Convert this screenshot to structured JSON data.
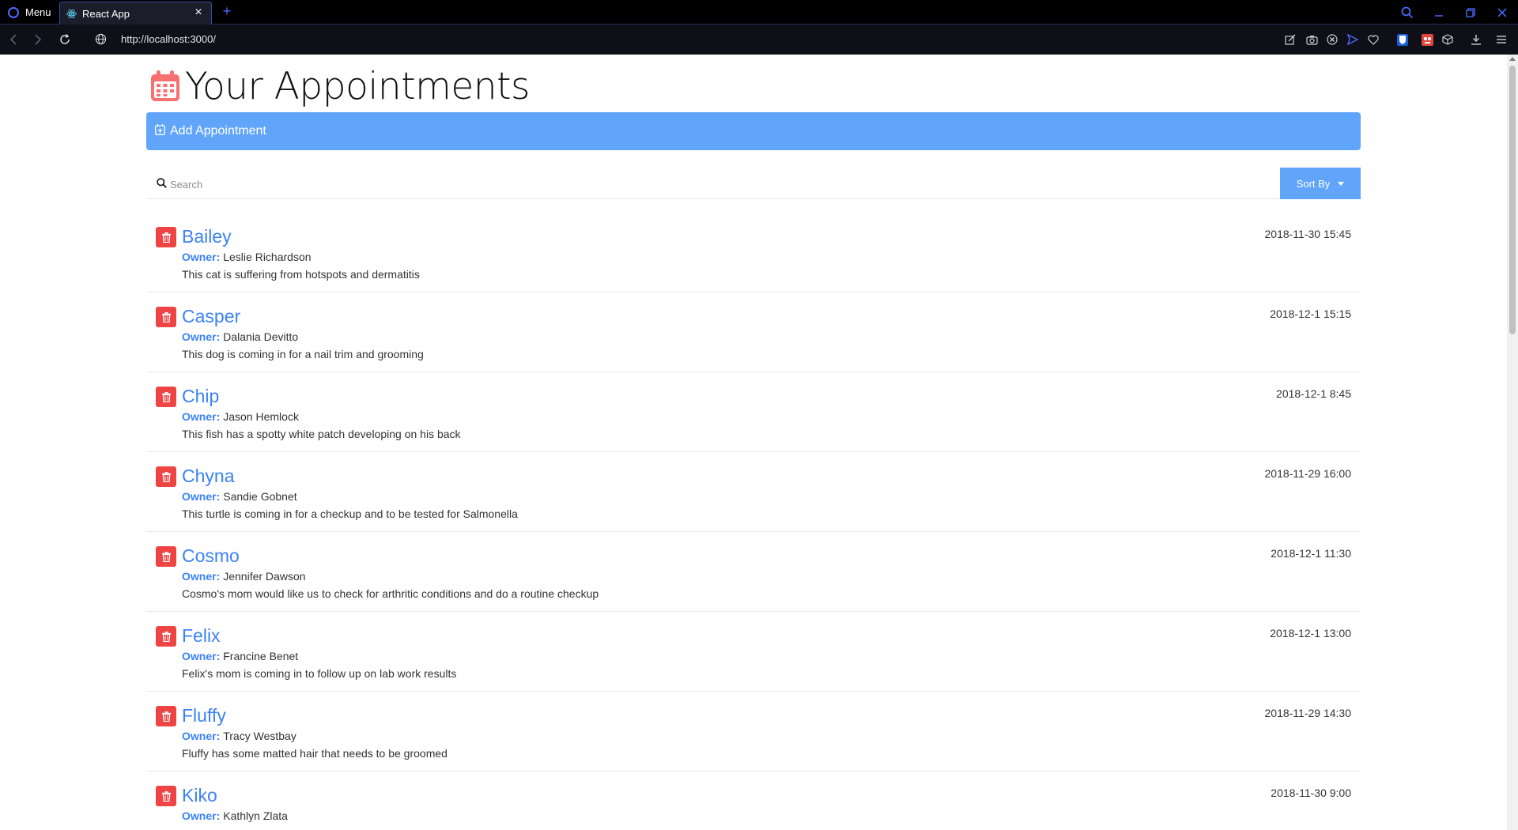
{
  "browser": {
    "menu_label": "Menu",
    "tab_title": "React App",
    "url": "http://localhost:3000/",
    "accent": "#4b6bff"
  },
  "page": {
    "title": "Your Appointments",
    "add_label": "Add Appointment",
    "search_placeholder": "Search",
    "sort_label": "Sort By",
    "owner_label": "Owner:",
    "accent": "#60a5fa",
    "link_color": "#3b82f6",
    "delete_color": "#ef4444"
  },
  "appointments": [
    {
      "pet": "Bailey",
      "owner": "Leslie Richardson",
      "notes": "This cat is suffering from hotspots and dermatitis",
      "date": "2018-11-30 15:45"
    },
    {
      "pet": "Casper",
      "owner": "Dalania Devitto",
      "notes": "This dog is coming in for a nail trim and grooming",
      "date": "2018-12-1 15:15"
    },
    {
      "pet": "Chip",
      "owner": "Jason Hemlock",
      "notes": "This fish has a spotty white patch developing on his back",
      "date": "2018-12-1 8:45"
    },
    {
      "pet": "Chyna",
      "owner": "Sandie Gobnet",
      "notes": "This turtle is coming in for a checkup and to be tested for Salmonella",
      "date": "2018-11-29 16:00"
    },
    {
      "pet": "Cosmo",
      "owner": "Jennifer Dawson",
      "notes": "Cosmo's mom would like us to check for arthritic conditions and do a routine checkup",
      "date": "2018-12-1 11:30"
    },
    {
      "pet": "Felix",
      "owner": "Francine Benet",
      "notes": "Felix's mom is coming in to follow up on lab work results",
      "date": "2018-12-1 13:00"
    },
    {
      "pet": "Fluffy",
      "owner": "Tracy Westbay",
      "notes": "Fluffy has some matted hair that needs to be groomed",
      "date": "2018-11-29 14:30"
    },
    {
      "pet": "Kiko",
      "owner": "Kathlyn Zlata",
      "notes": "",
      "date": "2018-11-30 9:00"
    }
  ]
}
